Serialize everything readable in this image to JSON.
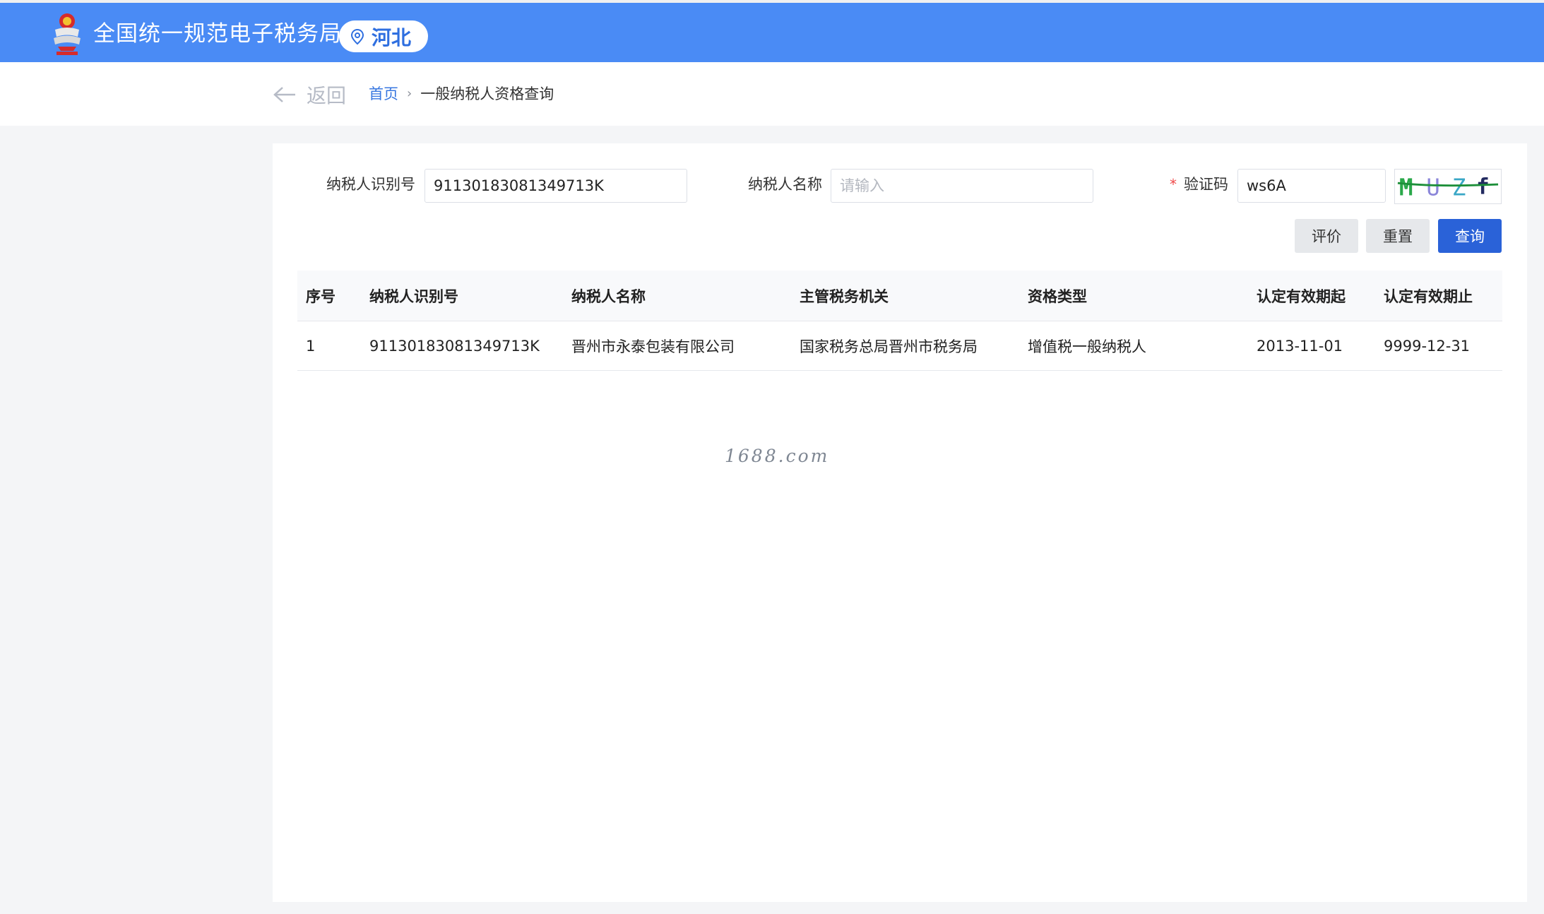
{
  "header": {
    "title": "全国统一规范电子税务局",
    "region": "河北",
    "emblem_icon": "tax-emblem-icon",
    "pin_icon": "location-pin-icon"
  },
  "subnav": {
    "back_label": "返回",
    "breadcrumb": {
      "home": "首页",
      "separator": "›",
      "current": "一般纳税人资格查询"
    }
  },
  "form": {
    "taxpayer_id": {
      "label": "纳税人识别号",
      "value": "91130183081349713K",
      "placeholder": ""
    },
    "taxpayer_name": {
      "label": "纳税人名称",
      "value": "",
      "placeholder": "请输入"
    },
    "captcha": {
      "required_mark": "*",
      "label": "验证码",
      "value": "ws6A",
      "placeholder": ""
    }
  },
  "buttons": {
    "evaluate": "评价",
    "reset": "重置",
    "query": "查询"
  },
  "table": {
    "columns": [
      "序号",
      "纳税人识别号",
      "纳税人名称",
      "主管税务机关",
      "资格类型",
      "认定有效期起",
      "认定有效期止"
    ],
    "rows": [
      [
        "1",
        "91130183081349713K",
        "晋州市永泰包装有限公司",
        "国家税务总局晋州市税务局",
        "增值税一般纳税人",
        "2013-11-01",
        "9999-12-31"
      ]
    ]
  },
  "watermark": "1688.com",
  "colors": {
    "header_bg": "#4a8bf5",
    "primary_button": "#2a62d8",
    "link": "#3877e0",
    "required": "#f04a4a"
  }
}
